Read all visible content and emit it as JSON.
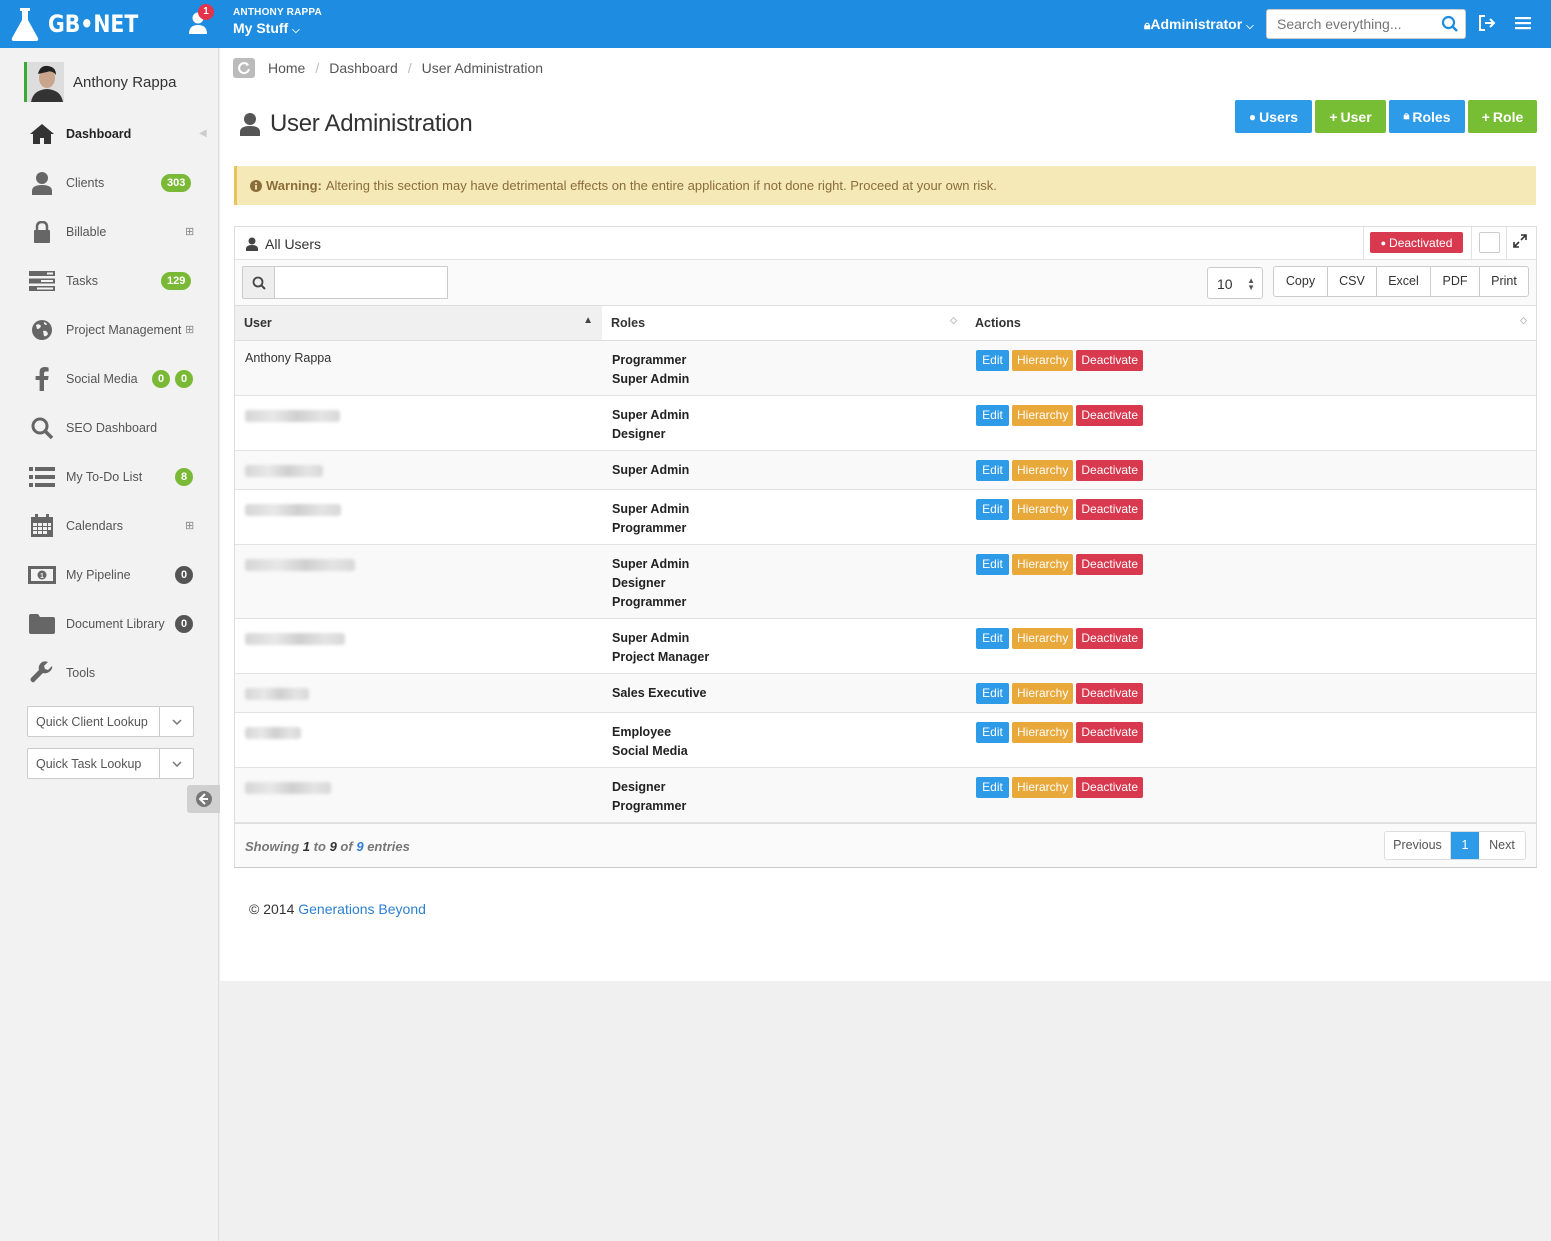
{
  "app": {
    "logo_text": "GB•NET"
  },
  "topbar": {
    "notification_count": "1",
    "user_name": "ANTHONY RAPPA",
    "menu_label": "My Stuff",
    "role_label": "Administrator",
    "search_placeholder": "Search everything..."
  },
  "sidebar": {
    "profile_name": "Anthony Rappa",
    "items": [
      {
        "label": "Dashboard",
        "icon": "home-icon"
      },
      {
        "label": "Clients",
        "icon": "user-icon",
        "badge": "303"
      },
      {
        "label": "Billable",
        "icon": "lock-icon",
        "expand": "⊞"
      },
      {
        "label": "Tasks",
        "icon": "tasks-icon",
        "badge": "129"
      },
      {
        "label": "Project Management",
        "icon": "globe-icon",
        "expand": "⊞"
      },
      {
        "label": "Social Media",
        "icon": "facebook-icon",
        "badges": [
          "0",
          "0"
        ]
      },
      {
        "label": "SEO Dashboard",
        "icon": "search-icon"
      },
      {
        "label": "My To-Do List",
        "icon": "list-icon",
        "badge": "8"
      },
      {
        "label": "Calendars",
        "icon": "calendar-icon",
        "expand": "⊞"
      },
      {
        "label": "My Pipeline",
        "icon": "money-icon",
        "badge": "0"
      },
      {
        "label": "Document Library",
        "icon": "folder-icon",
        "badge": "0"
      },
      {
        "label": "Tools",
        "icon": "wrench-icon"
      }
    ],
    "quick_client_lookup": "Quick Client Lookup",
    "quick_task_lookup": "Quick Task Lookup"
  },
  "breadcrumb": [
    "Home",
    "Dashboard",
    "User Administration"
  ],
  "page": {
    "title": "User Administration",
    "buttons": {
      "users": "Users",
      "add_user": "User",
      "roles": "Roles",
      "add_role": "Role"
    }
  },
  "warning": {
    "label": "Warning:",
    "text": "Altering this section may have detrimental effects on the entire application if not done right. Proceed at your own risk."
  },
  "panel": {
    "title": "All Users",
    "deactivated_toggle": "Deactivated",
    "page_length": "10",
    "export_buttons": [
      "Copy",
      "CSV",
      "Excel",
      "PDF",
      "Print"
    ],
    "columns": [
      "User",
      "Roles",
      "Actions"
    ],
    "action_labels": {
      "edit": "Edit",
      "hierarchy": "Hierarchy",
      "deactivate": "Deactivate"
    },
    "rows": [
      {
        "user": "Anthony Rappa",
        "roles": [
          "Programmer",
          "Super Admin"
        ]
      },
      {
        "user": "",
        "roles": [
          "Super Admin",
          "Designer"
        ]
      },
      {
        "user": "",
        "roles": [
          "Super Admin"
        ]
      },
      {
        "user": "",
        "roles": [
          "Super Admin",
          "Programmer"
        ]
      },
      {
        "user": "",
        "roles": [
          "Super Admin",
          "Designer",
          "Programmer"
        ]
      },
      {
        "user": "",
        "roles": [
          "Super Admin",
          "Project Manager"
        ]
      },
      {
        "user": "",
        "roles": [
          "Sales Executive"
        ]
      },
      {
        "user": "",
        "roles": [
          "Employee",
          "Social Media"
        ]
      },
      {
        "user": "",
        "roles": [
          "Designer",
          "Programmer"
        ]
      }
    ],
    "info": {
      "prefix": "Showing",
      "start": "1",
      "to": "to",
      "end": "9",
      "of": "of",
      "total": "9",
      "suffix": "entries"
    },
    "pagination": {
      "previous": "Previous",
      "current": "1",
      "next": "Next"
    }
  },
  "footer": {
    "copyright": "© 2014",
    "link": "Generations Beyond"
  },
  "colors": {
    "primary": "#1e8ce0",
    "success": "#78be34",
    "danger": "#d9394f",
    "warning_btn": "#e8a83a",
    "alert_bg": "#f5e9b8"
  }
}
